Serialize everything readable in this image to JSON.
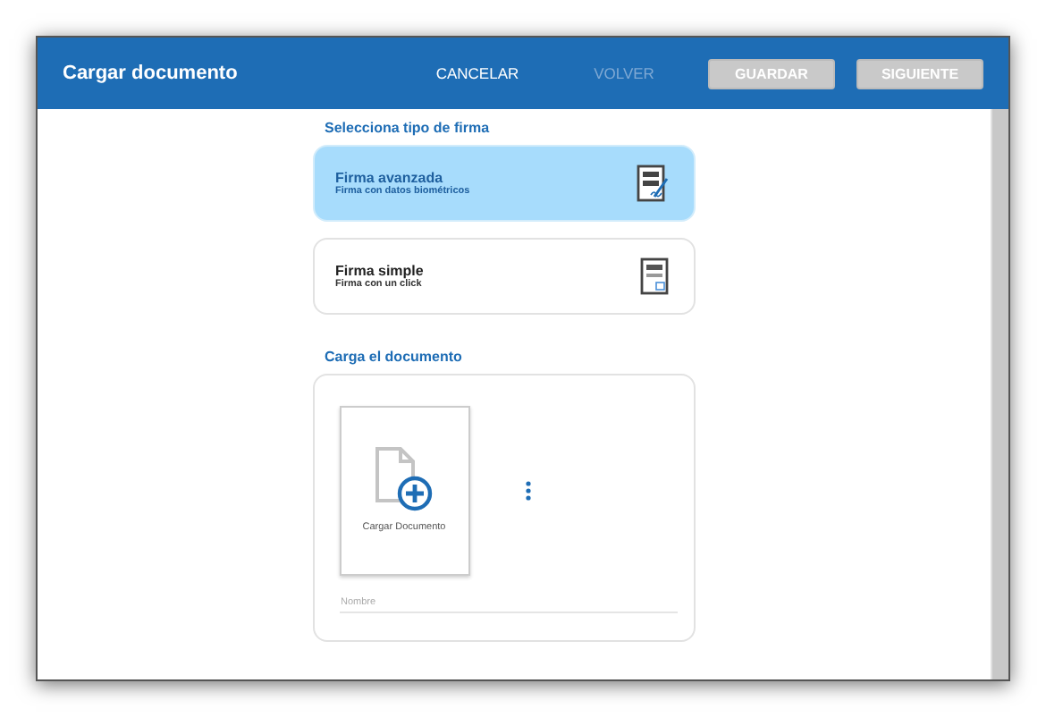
{
  "window": {
    "title": "Cargar documento"
  },
  "header_actions": [
    {
      "label": "CANCELAR",
      "kind": "link",
      "disabled": false
    },
    {
      "label": "VOLVER",
      "kind": "link",
      "disabled": true
    },
    {
      "label": "GUARDAR",
      "kind": "button",
      "disabled": true
    },
    {
      "label": "SIGUIENTE",
      "kind": "button",
      "disabled": true
    }
  ],
  "signature_section": {
    "title": "Selecciona tipo de firma",
    "options": [
      {
        "title": "Firma avanzada",
        "subtitle": "Firma con datos biométricos",
        "selected": true,
        "kind": "advanced"
      },
      {
        "title": "Firma simple",
        "subtitle": "Firma con un click",
        "selected": false,
        "kind": "simple"
      }
    ]
  },
  "document_section": {
    "title": "Carga el documento",
    "upload_label": "Cargar Documento",
    "name_field": {
      "placeholder": "Nombre"
    }
  }
}
